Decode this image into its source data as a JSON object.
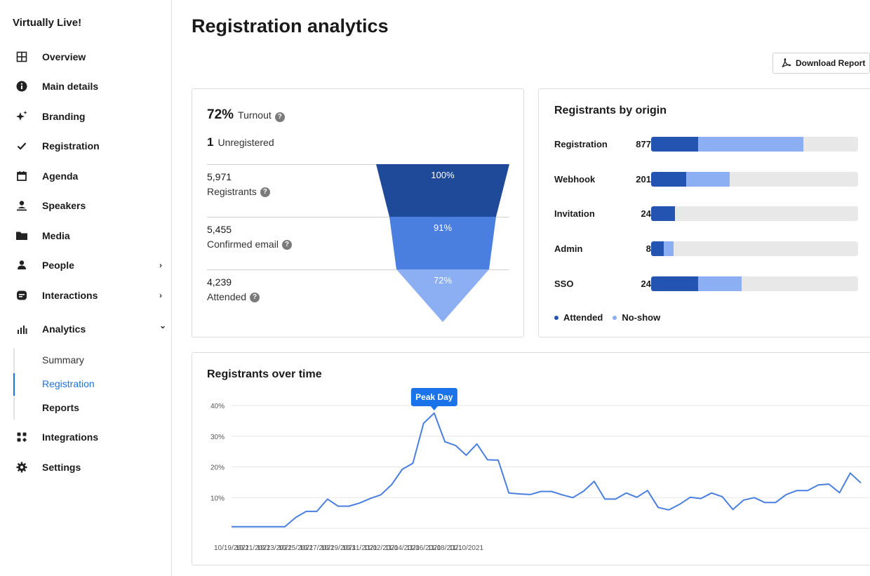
{
  "sidebar": {
    "brand": "Virtually Live!",
    "items": [
      {
        "label": "Overview",
        "icon": "grid-icon"
      },
      {
        "label": "Main details",
        "icon": "info-icon"
      },
      {
        "label": "Branding",
        "icon": "sparkle-icon"
      },
      {
        "label": "Registration",
        "icon": "check-icon"
      },
      {
        "label": "Agenda",
        "icon": "calendar-icon"
      },
      {
        "label": "Speakers",
        "icon": "speaker-icon"
      },
      {
        "label": "Media",
        "icon": "folder-icon"
      },
      {
        "label": "People",
        "icon": "person-icon",
        "chevron": "›"
      },
      {
        "label": "Interactions",
        "icon": "chat-icon",
        "chevron": "›"
      },
      {
        "label": "Analytics",
        "icon": "bar-chart-icon",
        "chevron": "⌄"
      },
      {
        "label": "Integrations",
        "icon": "apps-icon"
      },
      {
        "label": "Settings",
        "icon": "gear-icon"
      }
    ],
    "analytics_sub": [
      {
        "label": "Summary",
        "active": false
      },
      {
        "label": "Registration",
        "active": true
      },
      {
        "label": "Reports",
        "active": false
      }
    ]
  },
  "header": {
    "title": "Registration analytics",
    "download_label": "Download Report"
  },
  "funnel_card": {
    "turnout_value": "72%",
    "turnout_label": "Turnout",
    "unregistered_value": "1",
    "unregistered_label": "Unregistered",
    "rows": [
      {
        "value": "5,971",
        "label": "Registrants",
        "percent": "100%"
      },
      {
        "value": "5,455",
        "label": "Confirmed email",
        "percent": "91%"
      },
      {
        "value": "4,239",
        "label": "Attended",
        "percent": "72%"
      }
    ]
  },
  "origin_card": {
    "title": "Registrants by origin",
    "rows": [
      {
        "name": "Registration",
        "value": "877",
        "attended_frac": 0.227,
        "noshow_frac": 0.51
      },
      {
        "name": "Webhook",
        "value": "201",
        "attended_frac": 0.17,
        "noshow_frac": 0.21
      },
      {
        "name": "Invitation",
        "value": "24",
        "attended_frac": 0.115,
        "noshow_frac": 0.0
      },
      {
        "name": "Admin",
        "value": "8",
        "attended_frac": 0.06,
        "noshow_frac": 0.05
      },
      {
        "name": "SSO",
        "value": "24",
        "attended_frac": 0.227,
        "noshow_frac": 0.21
      }
    ],
    "legend": [
      {
        "label": "Attended",
        "color": "#2454b1"
      },
      {
        "label": "No-show",
        "color": "#8caff3"
      }
    ]
  },
  "colors": {
    "accent": "#1a73e8",
    "funnel": [
      "#1f4a99",
      "#4a7fe0",
      "#8caff3"
    ],
    "line": "#4a7fe0"
  },
  "time_card": {
    "title": "Registrants over time",
    "tooltip": "Peak Day",
    "chart_data": {
      "type": "line",
      "yticks": [
        "40%",
        "30%",
        "20%",
        "10%"
      ],
      "ylim": [
        0,
        40
      ],
      "xtick_labels": [
        "10/19/2021",
        "10/21/2021",
        "10/23/2021",
        "10/25/2021",
        "10/27/2021",
        "10/29/2021",
        "10/31/2021",
        "11/02/2021",
        "11/04/2021",
        "11/06/2021",
        "11/08/2021",
        "11/10/2021"
      ],
      "start_date": "2021-10-19",
      "peak_index": 16,
      "values": [
        0.5,
        0.5,
        0.5,
        0.5,
        0.5,
        0.5,
        3.5,
        5.5,
        5.5,
        9.5,
        7.2,
        7.2,
        8.2,
        9.7,
        10.9,
        14.2,
        19.2,
        21.2,
        34.2,
        37.5,
        28.2,
        27.0,
        23.8,
        27.5,
        22.3,
        22.2,
        11.5,
        11.2,
        11.0,
        12.0,
        12.0,
        10.9,
        10.0,
        12.1,
        15.3,
        9.5,
        9.5,
        11.5,
        10.1,
        12.3,
        6.8,
        6.0,
        7.8,
        10.1,
        9.7,
        11.5,
        10.3,
        6.1,
        9.2,
        10.0,
        8.4,
        8.4,
        11.0,
        12.3,
        12.3,
        14.1,
        14.4,
        11.6,
        18.0,
        14.8
      ]
    }
  }
}
